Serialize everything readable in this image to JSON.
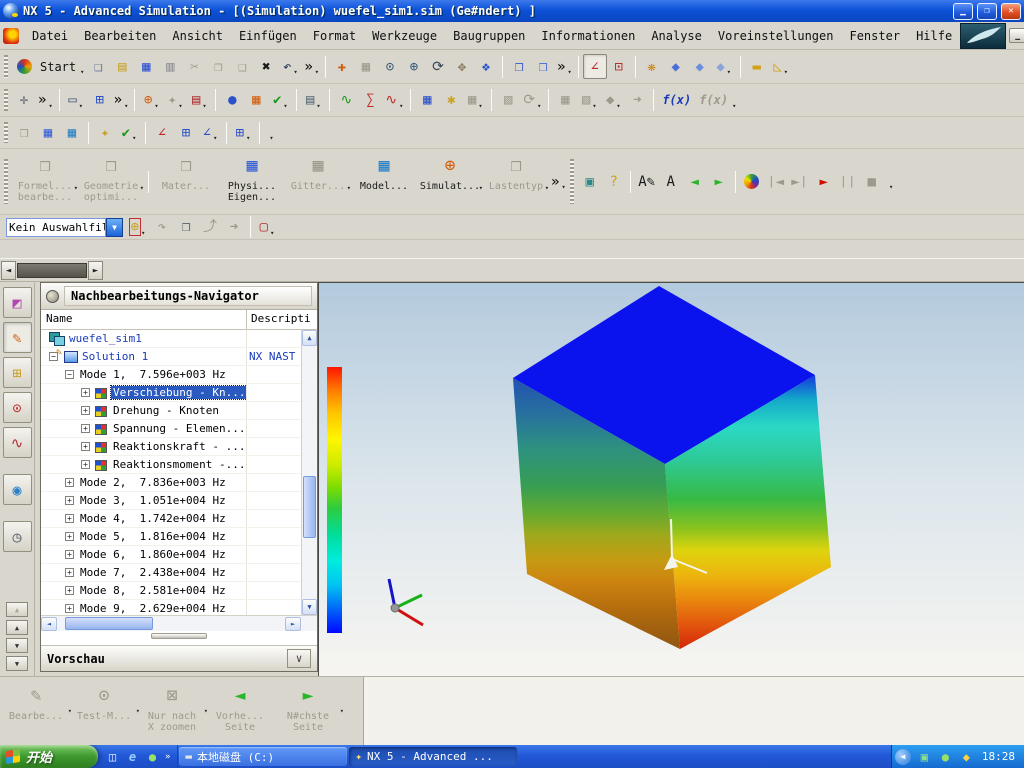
{
  "window": {
    "title": "NX 5 - Advanced Simulation - [(Simulation) wuefel_sim1.sim (Ge#ndert) ]"
  },
  "menu": {
    "items": [
      "Datei",
      "Bearbeiten",
      "Ansicht",
      "Einfügen",
      "Format",
      "Werkzeuge",
      "Baugruppen",
      "Informationen",
      "Analyse",
      "Voreinstellungen",
      "Fenster",
      "Hilfe"
    ]
  },
  "toolbars": {
    "row1": [
      {
        "sep": "grip"
      },
      {
        "name": "nx-start-logo-icon",
        "bg": "conic-gradient(#d83020,#f0a000,#30a030,#2050c8,#d83020)",
        "round": true
      },
      {
        "name": "start-menu-button",
        "text": "Start",
        "dd": true
      },
      {
        "name": "new-part-button",
        "glyph": "❏",
        "color": "#5a6a9a"
      },
      {
        "name": "open-button",
        "glyph": "▤",
        "color": "#c9a227"
      },
      {
        "name": "save-button",
        "glyph": "▦",
        "color": "#2b4fd0"
      },
      {
        "name": "print-button",
        "glyph": "▥",
        "color": "#8a8a92"
      },
      {
        "name": "cut-button",
        "glyph": "✂",
        "disabled": true
      },
      {
        "name": "copy-button",
        "glyph": "❐",
        "disabled": true
      },
      {
        "name": "paste-button",
        "glyph": "❑",
        "disabled": true
      },
      {
        "name": "delete-button",
        "glyph": "✖",
        "color": "#1a1a1a"
      },
      {
        "name": "undo-button",
        "glyph": "↶",
        "color": "#23355a",
        "dd": true
      },
      {
        "name": "toolbar-overflow-icon",
        "glyph": "»",
        "plain": true,
        "dd": true
      },
      {
        "sep": "line"
      },
      {
        "name": "fit-view-button",
        "glyph": "✚",
        "color": "#d06010"
      },
      {
        "name": "display-mode-button",
        "glyph": "▦",
        "disabled": true
      },
      {
        "name": "zoom-box-button",
        "glyph": "⊙",
        "color": "#35567a"
      },
      {
        "name": "zoom-in-out-button",
        "glyph": "⊕",
        "color": "#35567a"
      },
      {
        "name": "rotate-view-button",
        "glyph": "⟳",
        "color": "#34455a"
      },
      {
        "name": "pan-button",
        "glyph": "✥",
        "color": "#8a7a5a"
      },
      {
        "name": "shaded-view-button",
        "glyph": "❖",
        "color": "#2a52c8"
      },
      {
        "sep": "line"
      },
      {
        "name": "move-body-button",
        "glyph": "❒",
        "color": "#2a52c8"
      },
      {
        "name": "mirror-body-button",
        "glyph": "❒",
        "color": "#3a6ad8"
      },
      {
        "name": "toolbar-overflow-icon",
        "glyph": "»",
        "plain": true,
        "dd": true
      },
      {
        "sep": "line"
      },
      {
        "name": "csys-orient-button",
        "glyph": "∠",
        "color": "#c02828",
        "pressed": true
      },
      {
        "name": "node-select-button",
        "glyph": "⊡",
        "color": "#b03030"
      },
      {
        "sep": "line"
      },
      {
        "name": "role-palette-button",
        "glyph": "❋",
        "color": "#c8820a"
      },
      {
        "name": "view-operation-back-button",
        "glyph": "◆",
        "color": "#4a6fd8"
      },
      {
        "name": "view-operation-up-button",
        "glyph": "◆",
        "color": "#6a8fe0"
      },
      {
        "name": "view-operation-swap-button",
        "glyph": "◆",
        "color": "#8aa4d8",
        "dd": true
      },
      {
        "sep": "line"
      },
      {
        "name": "measure-distance-button",
        "glyph": "▬",
        "color": "#d4a017"
      },
      {
        "name": "measure-angle-button",
        "glyph": "◺",
        "color": "#d4a017",
        "dd": true
      }
    ],
    "row2": [
      {
        "sep": "grip"
      },
      {
        "name": "point-constructor-button",
        "glyph": "✛",
        "color": "#5a5a6a"
      },
      {
        "name": "toolbar-overflow-icon",
        "glyph": "»",
        "plain": true,
        "dd": true
      },
      {
        "sep": "line"
      },
      {
        "name": "rectangle-style-button",
        "glyph": "▭",
        "color": "#44507a",
        "dd": true
      },
      {
        "name": "layer-visibility-button",
        "glyph": "⊞",
        "color": "#2a52c8"
      },
      {
        "name": "toolbar-overflow-icon",
        "glyph": "»",
        "plain": true,
        "dd": true
      },
      {
        "sep": "line"
      },
      {
        "name": "csys-target-button",
        "glyph": "⊕",
        "color": "#d06010",
        "dd": true
      },
      {
        "name": "mesh-tool-button",
        "glyph": "✦",
        "disabled": true,
        "dd": true
      },
      {
        "name": "constraint-type-button",
        "glyph": "▤",
        "color": "#b03030",
        "dd": true
      },
      {
        "sep": "line"
      },
      {
        "name": "spheres-display-button",
        "glyph": "●",
        "color": "#2a52c8"
      },
      {
        "name": "window-layout-button",
        "glyph": "▦",
        "color": "#d06010"
      },
      {
        "name": "check-geometry-button",
        "glyph": "✔",
        "color": "#1a9a1a",
        "dd": true
      },
      {
        "sep": "line"
      },
      {
        "name": "report-list-button",
        "glyph": "▤",
        "color": "#566a7a",
        "dd": true
      },
      {
        "sep": "line"
      },
      {
        "name": "xy-plot-button",
        "glyph": "∿",
        "color": "#1a9a1a"
      },
      {
        "name": "sum-plot-button",
        "glyph": "∑",
        "color": "#c02828"
      },
      {
        "name": "multi-plot-button",
        "glyph": "∿",
        "color": "#c02828",
        "dd": true
      },
      {
        "sep": "line"
      },
      {
        "name": "calculator-plot-button",
        "glyph": "▦",
        "color": "#2a52c8"
      },
      {
        "name": "star-export-button",
        "glyph": "✱",
        "color": "#c9a227"
      },
      {
        "name": "gray-plot-button",
        "glyph": "▦",
        "disabled": true,
        "dd": true
      },
      {
        "sep": "line"
      },
      {
        "name": "animation-button",
        "glyph": "▧",
        "disabled": true
      },
      {
        "name": "rotate-result-button",
        "glyph": "⟳",
        "disabled": true,
        "dd": true
      },
      {
        "sep": "line"
      },
      {
        "name": "frame-back-button",
        "glyph": "▦",
        "disabled": true
      },
      {
        "name": "frame-play-button",
        "glyph": "▧",
        "disabled": true,
        "dd": true
      },
      {
        "name": "result-diamond-button",
        "glyph": "◆",
        "disabled": true,
        "dd": true
      },
      {
        "name": "export-frames-button",
        "glyph": "➜",
        "disabled": true
      },
      {
        "sep": "line"
      },
      {
        "name": "fx-edit-button",
        "fxtext": "f(x)",
        "color": "#1a3ab8"
      },
      {
        "name": "fx-view-button",
        "fxtext": "f(x)",
        "disabled": true,
        "dd": true
      }
    ],
    "row3": [
      {
        "sep": "grip"
      },
      {
        "name": "part-edit-button",
        "glyph": "❒",
        "disabled": true
      },
      {
        "name": "mesh-display-button",
        "glyph": "▦",
        "color": "#3a62d8"
      },
      {
        "name": "table-sheet-button",
        "glyph": "▦",
        "color": "#2a82c8"
      },
      {
        "sep": "line"
      },
      {
        "name": "settings-wrench-button",
        "glyph": "✦",
        "color": "#c9a227"
      },
      {
        "name": "validate-check-button",
        "glyph": "✔",
        "color": "#1a9a1a",
        "dd": true
      },
      {
        "sep": "line"
      },
      {
        "name": "csys-xyz-button",
        "glyph": "∠",
        "color": "#c02828"
      },
      {
        "name": "csys-info-button",
        "glyph": "⊞",
        "color": "#2a52c8"
      },
      {
        "name": "csys-info-axes-button",
        "glyph": "∠",
        "color": "#2a52c8",
        "dd": true
      },
      {
        "sep": "line"
      },
      {
        "name": "csys-grid-info-button",
        "glyph": "⊞",
        "color": "#2a52c8",
        "dd": true
      },
      {
        "sep": "line"
      },
      {
        "name": "toolbar-stub-icon",
        "glyph": "",
        "plain": true,
        "dd": true
      }
    ],
    "main": [
      {
        "sep": "grip"
      },
      {
        "name": "formel-bearbeiten-button",
        "big": true,
        "glyph": "❒",
        "disabled": true,
        "dd": true,
        "lines": [
          "Formel...",
          "bearbe..."
        ]
      },
      {
        "name": "geometrie-optimieren-button",
        "big": true,
        "glyph": "❒",
        "disabled": true,
        "dd": true,
        "lines": [
          "Geometrie",
          "optimi..."
        ]
      },
      {
        "sep": "line"
      },
      {
        "name": "material-button",
        "big": true,
        "glyph": "❒",
        "disabled": true,
        "lines": [
          "Mater...",
          ""
        ]
      },
      {
        "name": "physikalische-eigenschaften-button",
        "big": true,
        "glyph": "▦",
        "color": "#3a62d8",
        "lines": [
          "Physi...",
          "Eigen..."
        ]
      },
      {
        "name": "gitter-button",
        "big": true,
        "glyph": "▦",
        "disabled": true,
        "dd": true,
        "lines": [
          "Gitter...",
          ""
        ]
      },
      {
        "name": "modell-button",
        "big": true,
        "glyph": "▦",
        "color": "#2a82c8",
        "lines": [
          "Model...",
          ""
        ]
      },
      {
        "name": "simulation-button",
        "big": true,
        "glyph": "⊕",
        "color": "#d06010",
        "dd": true,
        "lines": [
          "Simulat...",
          ""
        ]
      },
      {
        "name": "lastentyp-button",
        "big": true,
        "glyph": "❒",
        "disabled": true,
        "dd": true,
        "lines": [
          "Lastentyp",
          ""
        ]
      },
      {
        "name": "toolbar-overflow-icon",
        "glyph": "»",
        "plain": true,
        "dd": true
      },
      {
        "sep": "grip"
      },
      {
        "name": "camera-button",
        "glyph": "▣",
        "color": "#2a8a8a"
      },
      {
        "name": "help-button",
        "glyph": "?",
        "color": "#d4a017"
      },
      {
        "sep": "line"
      },
      {
        "name": "annotation-edit-button",
        "glyph": "A✎",
        "color": "#1a1a1a"
      },
      {
        "name": "annotation-pick-button",
        "glyph": "A",
        "color": "#1a1a1a"
      },
      {
        "name": "previous-arrow-button",
        "glyph": "◄",
        "color": "#2ab52a"
      },
      {
        "name": "next-arrow-button",
        "glyph": "►",
        "color": "#2ab52a"
      },
      {
        "sep": "line"
      },
      {
        "name": "post-result-button",
        "bg": "conic-gradient(from 180deg,#d83020,#f0a000,#f0e000,#30a030,#2050c8,#6030a0,#d83020)",
        "round": true
      },
      {
        "name": "first-frame-button",
        "glyph": "❘◄",
        "disabled": true
      },
      {
        "name": "last-frame-button",
        "glyph": "►❘",
        "disabled": true
      },
      {
        "name": "play-button",
        "glyph": "►",
        "color": "#cc1100"
      },
      {
        "name": "pause-button",
        "glyph": "❘❘",
        "disabled": true
      },
      {
        "name": "stop-button",
        "glyph": "■",
        "disabled": true
      },
      {
        "name": "toolbar-overflow-icon",
        "glyph": "",
        "plain": true,
        "dd": true
      }
    ],
    "selection_icons": [
      {
        "name": "snap-point-button",
        "glyph": "⊕",
        "color": "#c9a227",
        "outlined": true,
        "dd": true
      },
      {
        "name": "redo-selection-button",
        "glyph": "↷",
        "disabled": true
      },
      {
        "name": "solid-select-button",
        "glyph": "❒",
        "color": "#55606a"
      },
      {
        "name": "rotate-selection-button",
        "glyph": "⤴",
        "disabled": true
      },
      {
        "name": "move-selection-button",
        "glyph": "➜",
        "disabled": true
      },
      {
        "sep": "line"
      },
      {
        "name": "rectangle-select-button",
        "glyph": "▢",
        "color": "#b03030",
        "dd": true
      }
    ],
    "bottom": [
      {
        "name": "bearbeiten-post-button",
        "glyph": "✎",
        "lines": [
          "Bearbe...",
          ""
        ],
        "dd": true
      },
      {
        "name": "test-messung-button",
        "glyph": "⊙",
        "lines": [
          "Test-M...",
          ""
        ],
        "dd": true
      },
      {
        "name": "nur-nach-x-zoomen-button",
        "glyph": "⊠",
        "lines": [
          "Nur nach",
          "X zoomen"
        ],
        "dd": true
      },
      {
        "name": "vorherige-seite-button",
        "glyph": "◄",
        "color": "#2ab52a",
        "lines": [
          "Vorhe...",
          "Seite"
        ]
      },
      {
        "name": "naechste-seite-button",
        "glyph": "►",
        "color": "#2ab52a",
        "lines": [
          "N#chste",
          "Seite"
        ],
        "dd": true
      }
    ]
  },
  "selection": {
    "filter_value": "Kein Auswahlfil"
  },
  "resource_tabs": [
    {
      "name": "simulation-navigator-tab",
      "glyph": "◩",
      "color": "#b048b0"
    },
    {
      "name": "post-navigator-tab",
      "glyph": "✎",
      "color": "#d06010",
      "active": true
    },
    {
      "name": "assembly-navigator-tab",
      "glyph": "⊞",
      "color": "#c9a227"
    },
    {
      "name": "constraint-navigator-tab",
      "glyph": "⊙",
      "color": "#c03030"
    },
    {
      "name": "xy-function-navigator-tab",
      "glyph": "∿",
      "color": "#b03030"
    },
    {
      "name": "internet-browser-tab",
      "glyph": "◉",
      "color": "#2a82c8",
      "gap": true
    },
    {
      "name": "history-tab",
      "glyph": "◷",
      "color": "#55606a",
      "gap": true
    }
  ],
  "navigator": {
    "title": "Nachbearbeitungs-Navigator",
    "columns": {
      "name": "Name",
      "desc": "Descripti"
    },
    "rows": [
      {
        "lvl": 0,
        "ico": "sim",
        "label": "wuefel_sim1",
        "blue": true
      },
      {
        "lvl": 0,
        "exp": "-",
        "ico": "sol",
        "label": "Solution 1",
        "desc": "NX NAST",
        "blue": true
      },
      {
        "lvl": 1,
        "exp": "-",
        "label": "Mode 1,  7.596e+003 Hz"
      },
      {
        "lvl": 2,
        "exp": "+",
        "ico": "res",
        "label": "Verschiebung - Kn...",
        "sel": true
      },
      {
        "lvl": 2,
        "exp": "+",
        "ico": "res",
        "label": "Drehung - Knoten"
      },
      {
        "lvl": 2,
        "exp": "+",
        "ico": "res",
        "label": "Spannung - Elemen..."
      },
      {
        "lvl": 2,
        "exp": "+",
        "ico": "res",
        "label": "Reaktionskraft - ..."
      },
      {
        "lvl": 2,
        "exp": "+",
        "ico": "res",
        "label": "Reaktionsmoment -..."
      },
      {
        "lvl": 1,
        "exp": "+",
        "label": "Mode 2,  7.836e+003 Hz"
      },
      {
        "lvl": 1,
        "exp": "+",
        "label": "Mode 3,  1.051e+004 Hz"
      },
      {
        "lvl": 1,
        "exp": "+",
        "label": "Mode 4,  1.742e+004 Hz"
      },
      {
        "lvl": 1,
        "exp": "+",
        "label": "Mode 5,  1.816e+004 Hz"
      },
      {
        "lvl": 1,
        "exp": "+",
        "label": "Mode 6,  1.860e+004 Hz"
      },
      {
        "lvl": 1,
        "exp": "+",
        "label": "Mode 7,  2.438e+004 Hz"
      },
      {
        "lvl": 1,
        "exp": "+",
        "label": "Mode 8,  2.581e+004 Hz"
      },
      {
        "lvl": 1,
        "exp": "+",
        "label": "Mode 9,  2.629e+004 Hz"
      }
    ],
    "preview_label": "Vorschau"
  },
  "viewport": {
    "top_face": "#0a12ee",
    "legend_stops": [
      [
        "#ff1400",
        0
      ],
      [
        "#ff7e00",
        9
      ],
      [
        "#ffc300",
        17
      ],
      [
        "#fff600",
        27
      ],
      [
        "#cdeb00",
        37
      ],
      [
        "#7fdd00",
        45
      ],
      [
        "#2ecc3e",
        53
      ],
      [
        "#00dd9a",
        63
      ],
      [
        "#00ecde",
        73
      ],
      [
        "#00c4f2",
        82
      ],
      [
        "#0070f8",
        90
      ],
      [
        "#0008ff",
        100
      ]
    ],
    "left_face_stops": [
      [
        "#2151b2",
        0
      ],
      [
        "#27709e",
        13
      ],
      [
        "#2d9180",
        26
      ],
      [
        "#379e52",
        40
      ],
      [
        "#64ab30",
        50
      ],
      [
        "#9fa91c",
        58
      ],
      [
        "#c59b12",
        67
      ],
      [
        "#cd8410",
        75
      ],
      [
        "#b26b0e",
        86
      ],
      [
        "#8f5510",
        100
      ]
    ],
    "right_face_stops": [
      [
        "#1636e0",
        0
      ],
      [
        "#13a9c9",
        9
      ],
      [
        "#2bd9c5",
        19
      ],
      [
        "#2eca97",
        31
      ],
      [
        "#36b945",
        45
      ],
      [
        "#8ac21e",
        56
      ],
      [
        "#ded40e",
        64
      ],
      [
        "#ecb50e",
        73
      ],
      [
        "#ea8d0e",
        81
      ],
      [
        "#e2570e",
        91
      ],
      [
        "#d42508",
        100
      ]
    ]
  },
  "taskbar": {
    "start_label": "开始",
    "tasks": [
      {
        "label": "本地磁盘 (C:)",
        "icon": "drive-icon",
        "icon_glyph": "▬",
        "icon_color": "#e4e4e4",
        "active": false
      },
      {
        "label": "NX 5 - Advanced ...",
        "icon": "nx-app-icon",
        "icon_glyph": "✦",
        "icon_color": "#ffe066",
        "active": true
      }
    ],
    "clock": "18:28"
  }
}
